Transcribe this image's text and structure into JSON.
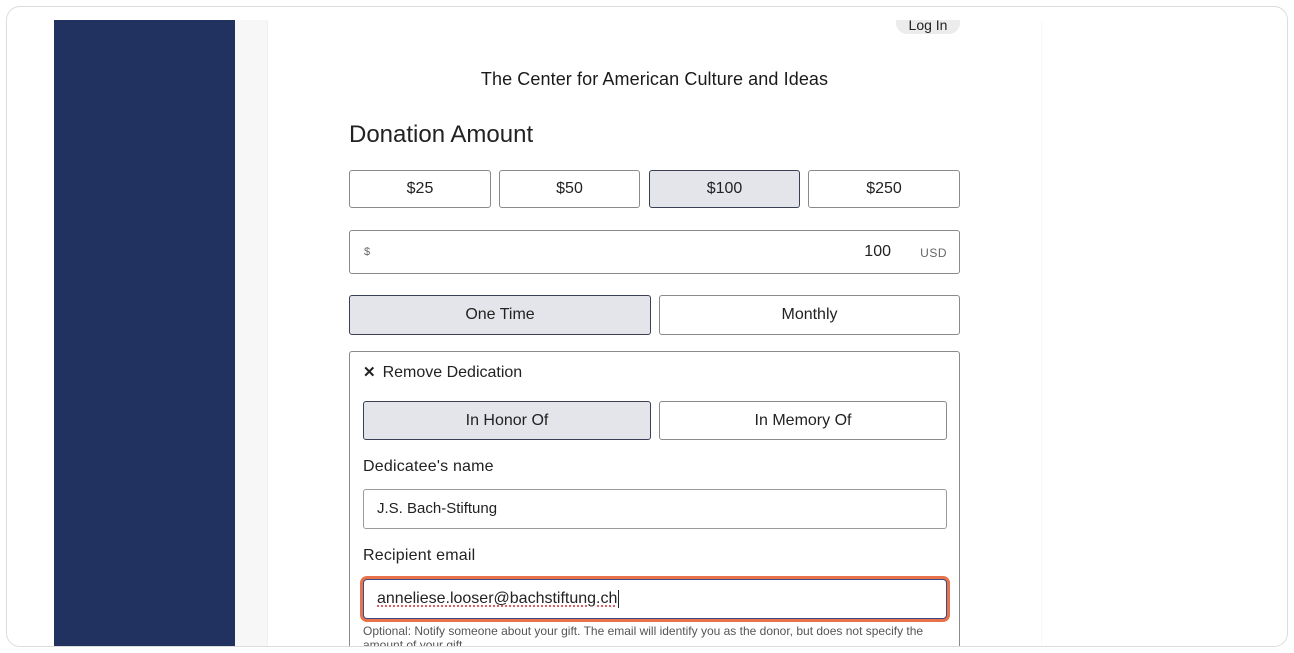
{
  "header": {
    "login_label": "Log In",
    "org_name": "The Center for American Culture and Ideas"
  },
  "donation": {
    "section_title": "Donation Amount",
    "preset_amounts": [
      {
        "label": "$25",
        "selected": false
      },
      {
        "label": "$50",
        "selected": false
      },
      {
        "label": "$100",
        "selected": true
      },
      {
        "label": "$250",
        "selected": false
      }
    ],
    "currency_symbol": "$",
    "amount_value": "100",
    "currency_code": "USD"
  },
  "frequency": {
    "options": [
      {
        "label": "One Time",
        "selected": true
      },
      {
        "label": "Monthly",
        "selected": false
      }
    ]
  },
  "dedication": {
    "remove_label": "Remove Dedication",
    "remove_icon": "close-icon",
    "types": [
      {
        "label": "In Honor Of",
        "selected": true
      },
      {
        "label": "In Memory Of",
        "selected": false
      }
    ],
    "dedicatee_label": "Dedicatee's name",
    "dedicatee_value": "J.S. Bach-Stiftung",
    "email_label": "Recipient email",
    "email_value": "anneliese.looser@bachstiftung.ch",
    "help_text": "Optional: Notify someone about your gift. The email will identify you as the donor, but does not specify the amount of your gift."
  },
  "colors": {
    "sidebar": "#213261",
    "selected_bg": "#e4e5ea",
    "focus_ring": "#e8724a"
  }
}
